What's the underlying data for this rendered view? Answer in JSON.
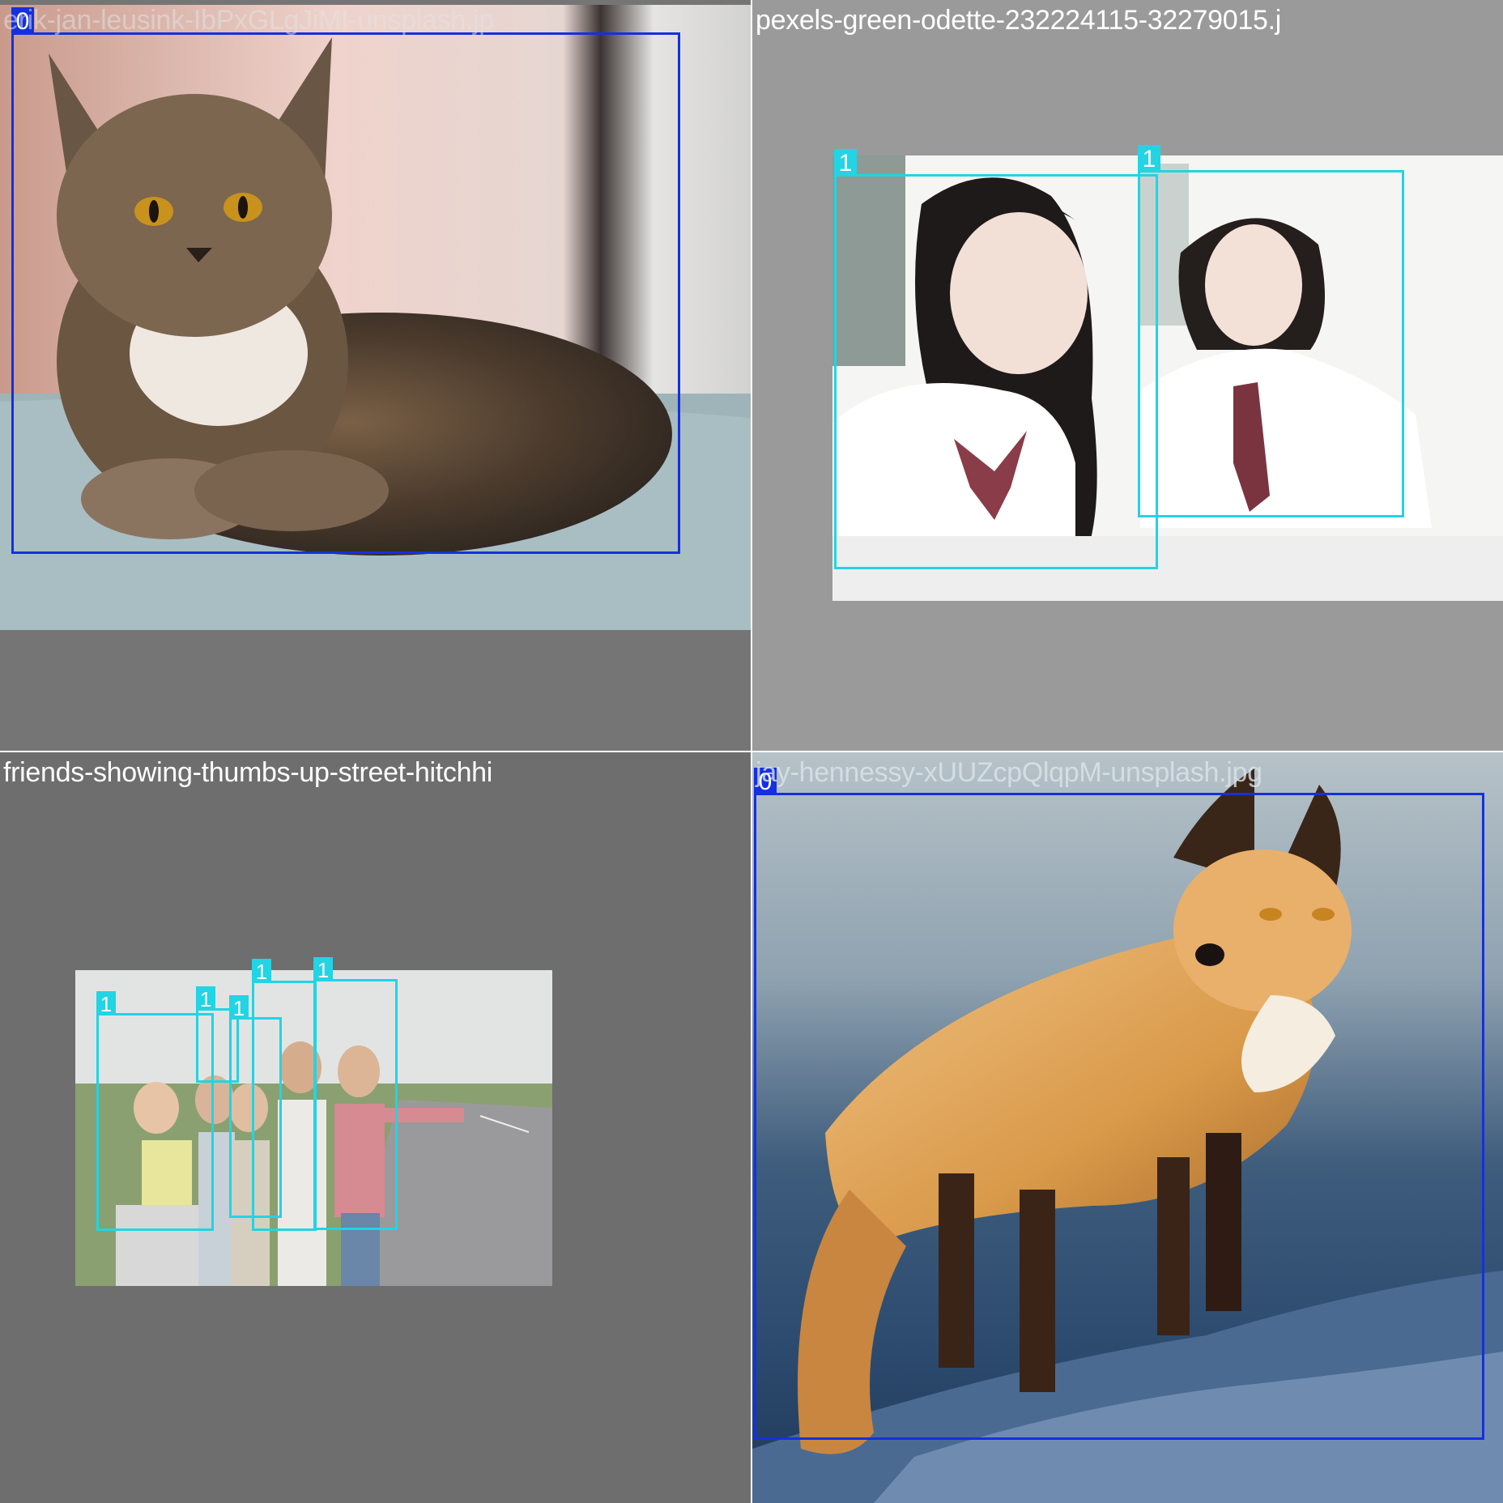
{
  "tiles": [
    {
      "filename": "erik-jan-leusink-IbPxGLgJiMI-unsplash.jp",
      "subject": "tabby cat lying on sofa",
      "boxes": [
        {
          "label": "0"
        }
      ]
    },
    {
      "filename": "pexels-green-odette-232224115-32279015.j",
      "subject": "two girls in school uniforms",
      "boxes": [
        {
          "label": "1"
        },
        {
          "label": "1"
        }
      ]
    },
    {
      "filename": "friends-showing-thumbs-up-street-hitchhi",
      "subject": "five friends hitchhiking on roadside",
      "boxes": [
        {
          "label": "1"
        },
        {
          "label": "1"
        },
        {
          "label": "1"
        },
        {
          "label": "1"
        },
        {
          "label": "1"
        }
      ]
    },
    {
      "filename": "jay-hennessy-xUUZcpQlqpM-unsplash.jpg",
      "subject": "red fox standing on snow",
      "boxes": [
        {
          "label": "0"
        }
      ]
    }
  ],
  "colors": {
    "class0": "#1430e0",
    "class1": "#22d4e4",
    "background_light": "#9a9a9a",
    "background_dark": "#6e6e6e"
  }
}
